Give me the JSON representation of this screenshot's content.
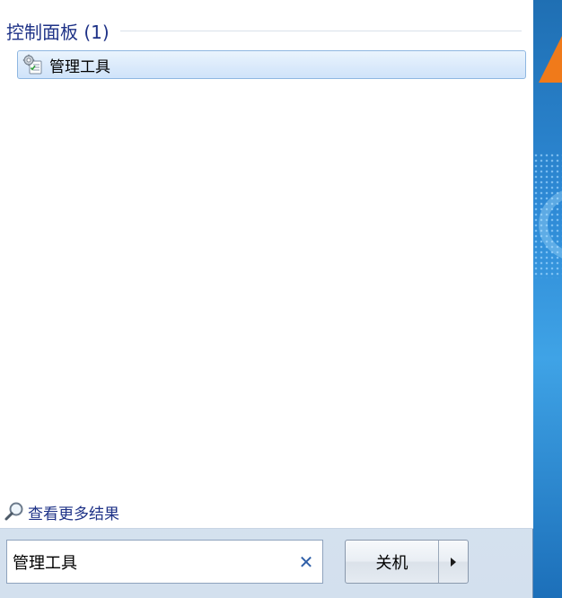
{
  "results": {
    "section_title": "控制面板 (1)",
    "items": [
      {
        "label": "管理工具",
        "icon": "admin-tools-icon"
      }
    ],
    "see_more_label": "查看更多结果",
    "see_more_icon": "magnifier-icon"
  },
  "search": {
    "value": "管理工具",
    "clear_icon": "close-icon"
  },
  "shutdown": {
    "label": "关机",
    "arrow_icon": "chevron-right-icon"
  },
  "colors": {
    "header_text": "#1e3287",
    "selection_border": "#8fb7e1",
    "wallpaper_accent": "#f07a1a"
  }
}
